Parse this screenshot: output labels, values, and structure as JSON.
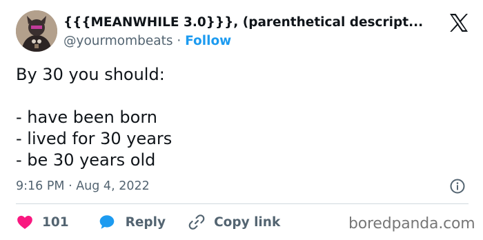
{
  "author": {
    "display_name": "{{{MEANWHILE 3.0}}}, (parenthetical descript...",
    "handle": "@yourmombeats",
    "separator": "·",
    "follow_label": "Follow",
    "avatar_icon": "profile-avatar"
  },
  "tweet": {
    "lines": [
      "By 30 you should:",
      "",
      "- have been born",
      "- lived for 30 years",
      "- be 30 years old"
    ],
    "timestamp": "9:16 PM · Aug 4, 2022"
  },
  "actions": {
    "like_count": "101",
    "reply_label": "Reply",
    "copy_link_label": "Copy link"
  },
  "icons": {
    "brand": "x-logo-icon",
    "info": "info-icon",
    "like": "heart-icon",
    "reply": "speech-bubble-icon",
    "copy": "link-icon"
  },
  "colors": {
    "text": "#0f1419",
    "secondary": "#536471",
    "accent": "#1d9bf0",
    "like": "#f91880",
    "divider": "#cfd9de"
  },
  "watermark": "boredpanda.com"
}
